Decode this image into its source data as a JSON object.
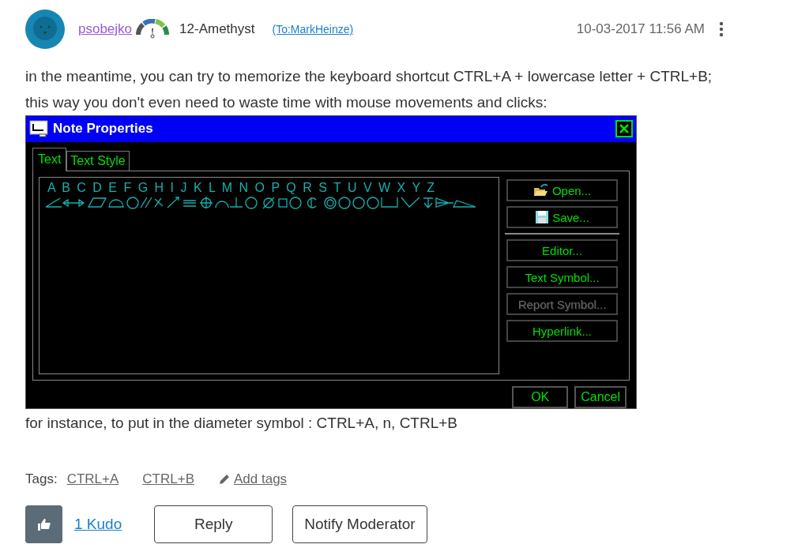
{
  "post": {
    "author": "psobejko",
    "rank": "12-Amethyst",
    "recipient": "(To:MarkHeinze)",
    "timestamp": "10-03-2017 11:56 AM"
  },
  "body": {
    "paragraph": "in the meantime, you can try to memorize the keyboard shortcut CTRL+A + lowercase letter + CTRL+B; this way you don't even need to waste time with mouse movements and clicks:",
    "caption": "for instance, to put in the diameter symbol : CTRL+A, n, CTRL+B"
  },
  "dialog": {
    "title": "Note Properties",
    "tabs": [
      {
        "label": "Text",
        "selected": true
      },
      {
        "label": "Text Style",
        "selected": false
      }
    ],
    "text_area": {
      "letters": "A B C D E F G H I J K L M N O P Q R S T U V W X Y Z"
    },
    "side_buttons": [
      {
        "kind": "open",
        "label": "Open...",
        "disabled": false
      },
      {
        "kind": "save",
        "label": "Save...",
        "disabled": false
      },
      {
        "kind": "separator"
      },
      {
        "kind": "plain",
        "label": "Editor...",
        "disabled": false
      },
      {
        "kind": "plain",
        "label": "Text Symbol...",
        "disabled": false
      },
      {
        "kind": "plain",
        "label": "Report Symbol...",
        "disabled": true
      },
      {
        "kind": "plain",
        "label": "Hyperlink...",
        "disabled": false
      }
    ],
    "footer_buttons": [
      "OK",
      "Cancel"
    ]
  },
  "tags": {
    "label": "Tags:",
    "items": [
      "CTRL+A",
      "CTRL+B"
    ],
    "add": "Add tags"
  },
  "actions": {
    "kudos": "1 Kudo",
    "buttons": [
      "Reply",
      "Notify Moderator"
    ]
  }
}
